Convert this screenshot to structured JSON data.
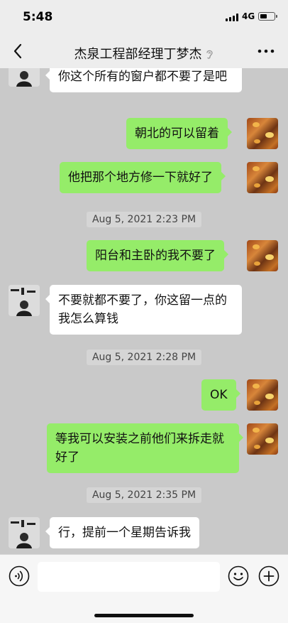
{
  "status_bar": {
    "time": "5:48",
    "network": "4G"
  },
  "header": {
    "title": "杰泉工程部经理丁梦杰",
    "icons": [
      "chevron-left-icon",
      "ear-icon",
      "more-dots-icon"
    ]
  },
  "messages": [
    {
      "type": "text",
      "sender": "friend",
      "text": "你这个所有的窗户都不要了是吧"
    },
    {
      "type": "text",
      "sender": "self",
      "text": "朝北的可以留着"
    },
    {
      "type": "text",
      "sender": "self",
      "text": "他把那个地方修一下就好了"
    },
    {
      "type": "timestamp",
      "text": "Aug 5, 2021 2:23 PM"
    },
    {
      "type": "text",
      "sender": "self",
      "text": "阳台和主卧的我不要了"
    },
    {
      "type": "text",
      "sender": "friend",
      "text": "不要就都不要了，你这留一点的我怎么算钱"
    },
    {
      "type": "timestamp",
      "text": "Aug 5, 2021 2:28 PM"
    },
    {
      "type": "text",
      "sender": "self",
      "text": "OK"
    },
    {
      "type": "text",
      "sender": "self",
      "text": "等我可以安装之前他们来拆走就好了"
    },
    {
      "type": "timestamp",
      "text": "Aug 5, 2021 2:35 PM"
    },
    {
      "type": "text",
      "sender": "friend",
      "text": "行，提前一个星期告诉我"
    }
  ],
  "input_bar": {
    "placeholder": "",
    "icons": [
      "voice-icon",
      "emoji-icon",
      "plus-icon"
    ]
  },
  "colors": {
    "chat_background": "#c9c9c9",
    "bubble_in": "#ffffff",
    "bubble_out": "#95ec69",
    "bar_background": "#ededed"
  }
}
